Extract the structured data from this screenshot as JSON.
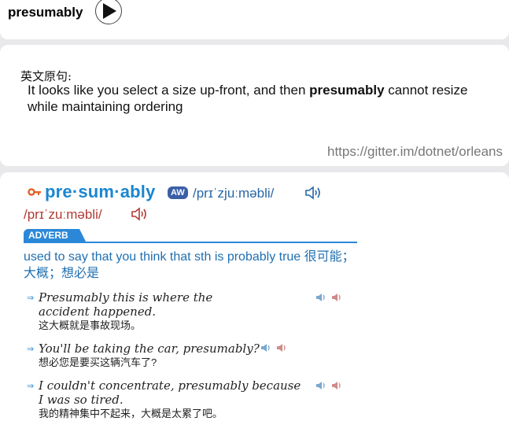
{
  "word_card": {
    "word": "presumably",
    "play_icon": "play-icon"
  },
  "source_card": {
    "label": "英文原句:",
    "sentence_before": "It looks like you select a size up-front, and then ",
    "sentence_bold": "presumably",
    "sentence_after": " cannot resize while maintaining ordering",
    "url": "https://gitter.im/dotnet/orleans"
  },
  "dictionary": {
    "key_icon": "key-icon",
    "headword": "pre·sum·ably",
    "badge": "AW",
    "pron_uk": "/prɪˈzjuːməbli/",
    "pron_us": "/prɪˈzuːməbli/",
    "pos": "ADVERB",
    "definition": "used to say that you think that sth is probably true 很可能；大概；想必是",
    "examples": [
      {
        "en": "Presumably this is where the accident happened.",
        "zh": "这大概就是事故现场。"
      },
      {
        "en": "You'll be taking the car, presumably?",
        "zh": "想必您是要买这辆汽车了?"
      },
      {
        "en": "I couldn't concentrate, presumably because I was so tired.",
        "zh": "我的精神集中不起来，大概是太累了吧。"
      }
    ],
    "colors": {
      "headword": "#1a86d0",
      "uk": "#2767a7",
      "us": "#b23a34",
      "accent": "#2b88d8",
      "badge": "#3a5fa7"
    }
  }
}
